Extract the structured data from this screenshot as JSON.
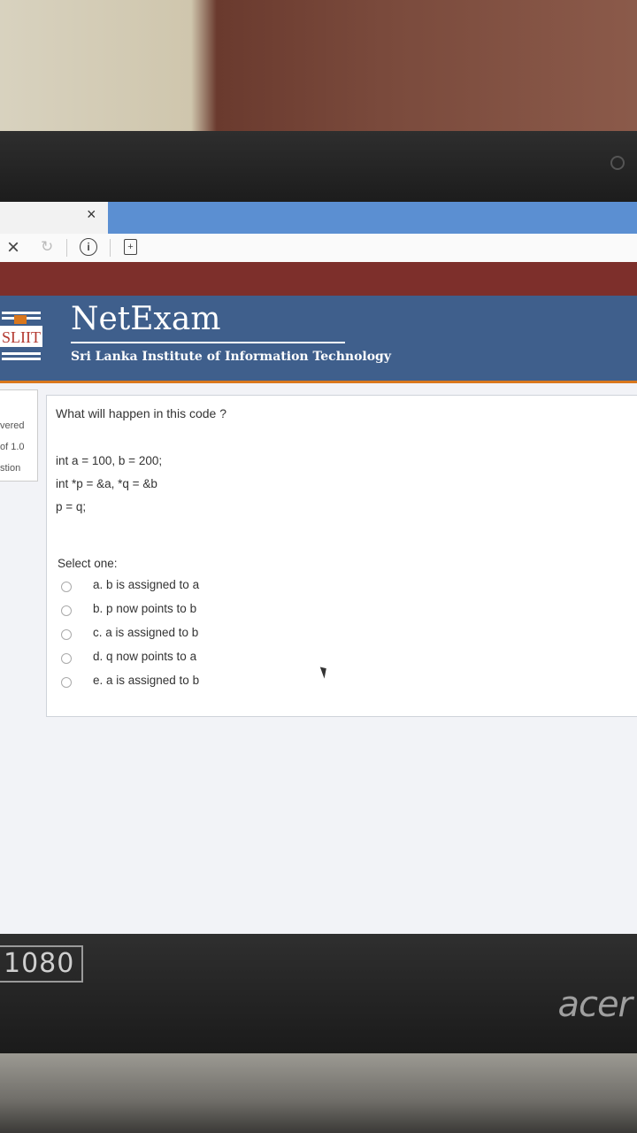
{
  "browser": {
    "tab_close": "×",
    "nav_stop": "×",
    "reload": "↻",
    "info": "i",
    "page_icon": "+"
  },
  "header": {
    "logo_text": "SLIIT",
    "site_title": "NetExam",
    "subtitle": "Sri Lanka Institute of Information Technology",
    "colors": {
      "red_bar": "#7d2f2b",
      "header_bg": "#3f5f8c",
      "accent": "#d9771d"
    }
  },
  "info_box": {
    "line1": "vered",
    "line2": "of 1.0",
    "line3": "stion"
  },
  "question": {
    "text": "What will happen in this code ?",
    "code": [
      "int a = 100, b = 200;",
      "int *p = &a, *q = &b",
      "p = q;"
    ],
    "select_label": "Select one:",
    "options": [
      {
        "label": "a. b is assigned to a"
      },
      {
        "label": "b. p now points to b"
      },
      {
        "label": "c. a is assigned to b"
      },
      {
        "label": "d. q now points to a"
      },
      {
        "label": "e. a is assigned to b"
      }
    ]
  },
  "device": {
    "badge": "1080",
    "brand": "acer"
  }
}
